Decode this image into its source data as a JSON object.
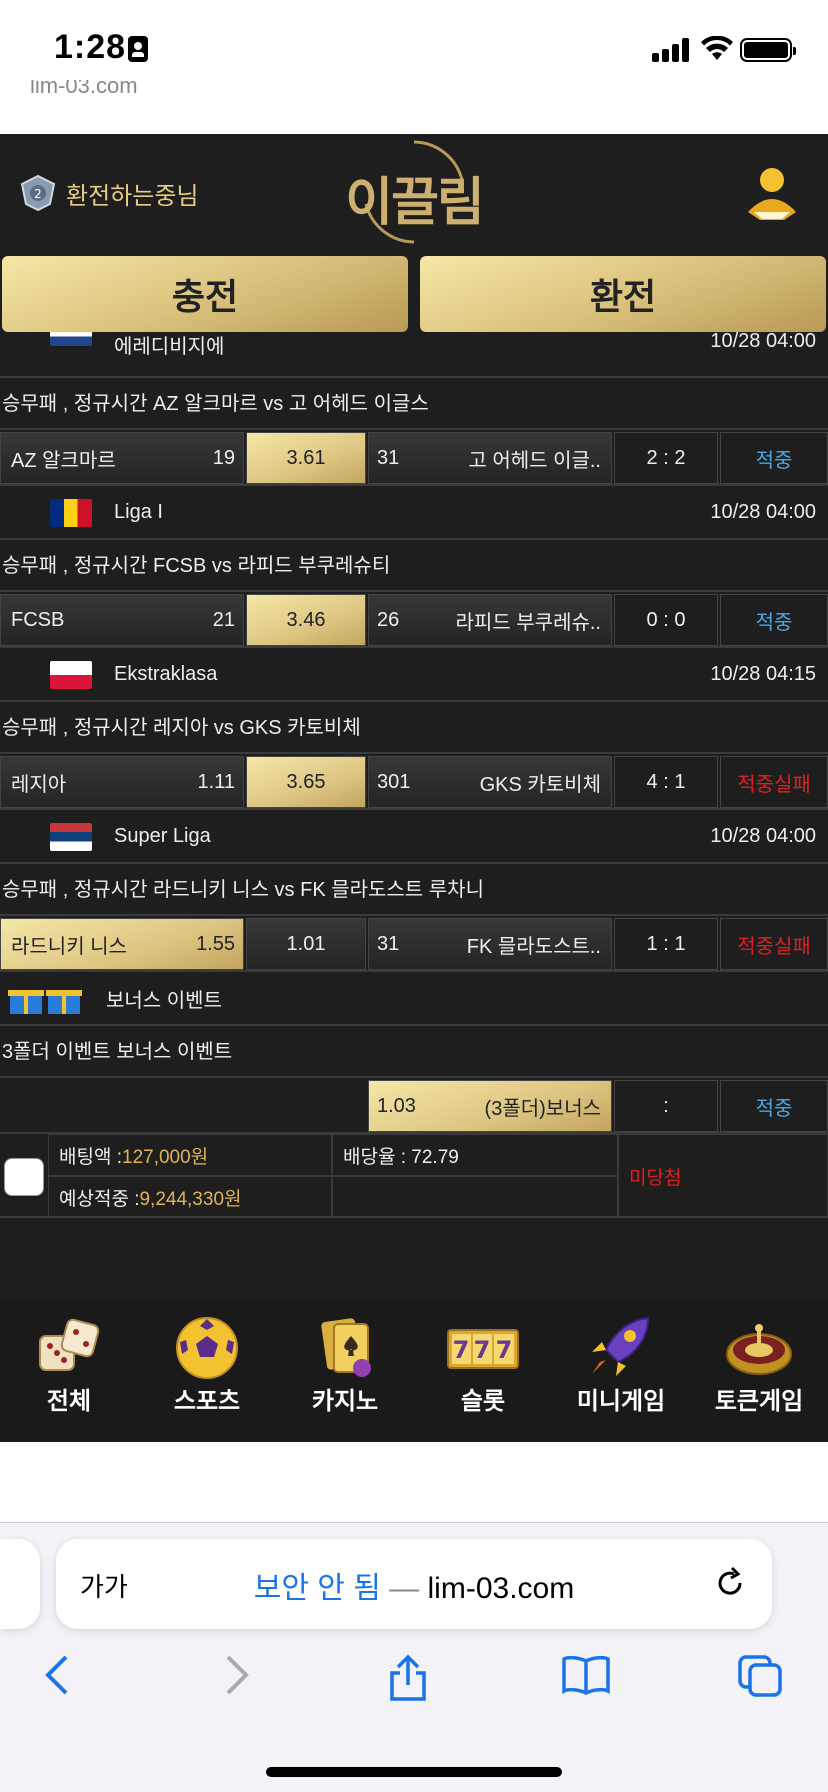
{
  "status": {
    "time": "1:28"
  },
  "url_peek": "lim-03.com",
  "header": {
    "username": "환전하는중님",
    "logo_text": "이끌림",
    "charge_label": "충전",
    "exchange_label": "환전"
  },
  "partial_league": {
    "name": "에레디비지에",
    "date": "10/28 04:00"
  },
  "bets": [
    {
      "market": "승무패 , 정규시간 AZ 알크마르  vs  고 어헤드 이글스",
      "home": "AZ 알크마르",
      "home_odds": "19",
      "draw": "3.61",
      "away_odds": "31",
      "away": "고 어헤드 이글..",
      "score": "2 : 2",
      "result": "적중",
      "selected": "draw"
    },
    {
      "league": "Liga I",
      "date": "10/28 04:00",
      "flag": "romania",
      "market": "승무패 , 정규시간 FCSB  vs  라피드 부쿠레슈티",
      "home": "FCSB",
      "home_odds": "21",
      "draw": "3.46",
      "away_odds": "26",
      "away": "라피드 부쿠레슈..",
      "score": "0 : 0",
      "result": "적중",
      "selected": "draw"
    },
    {
      "league": "Ekstraklasa",
      "date": "10/28 04:15",
      "flag": "poland",
      "market": "승무패 , 정규시간 레지아  vs  GKS 카토비체",
      "home": "레지아",
      "home_odds": "1.11",
      "draw": "3.65",
      "away_odds": "301",
      "away": "GKS 카토비체",
      "score": "4 : 1",
      "result": "적중실패",
      "selected": "draw"
    },
    {
      "league": "Super Liga",
      "date": "10/28 04:00",
      "flag": "serbia",
      "market": "승무패 , 정규시간 라드니키 니스  vs  FK 믈라도스트 루차니",
      "home": "라드니키 니스",
      "home_odds": "1.55",
      "draw": "1.01",
      "away_odds": "31",
      "away": "FK 믈라도스트..",
      "score": "1 : 1",
      "result": "적중실패",
      "selected": "home"
    }
  ],
  "bonus": {
    "title": "보너스 이벤트",
    "market": "3폴더 이벤트 보너스 이벤트",
    "odds": "1.03",
    "label": "(3폴더)보너스",
    "score": ":",
    "result": "적중"
  },
  "summary": {
    "bet_amount_label": "배팅액 : ",
    "bet_amount": "127,000원",
    "odds_label": "배당율 : 72.79",
    "expected_label": "예상적중 : ",
    "expected": "9,244,330원",
    "status": "미당첨"
  },
  "nav": [
    {
      "label": "전체",
      "icon": "dice-icon"
    },
    {
      "label": "스포츠",
      "icon": "soccer-ball-icon"
    },
    {
      "label": "카지노",
      "icon": "cards-icon"
    },
    {
      "label": "슬롯",
      "icon": "slot-777-icon"
    },
    {
      "label": "미니게임",
      "icon": "rocket-icon"
    },
    {
      "label": "토큰게임",
      "icon": "roulette-icon"
    }
  ],
  "safari": {
    "aa": "가가",
    "not_secure": "보안 안 됨",
    "sep": " — ",
    "domain": "lim-03.com"
  },
  "colors": {
    "gold": "#d9c07a",
    "hit": "#4aa8e8",
    "miss": "#e02020",
    "bg": "#1e1e1e"
  }
}
